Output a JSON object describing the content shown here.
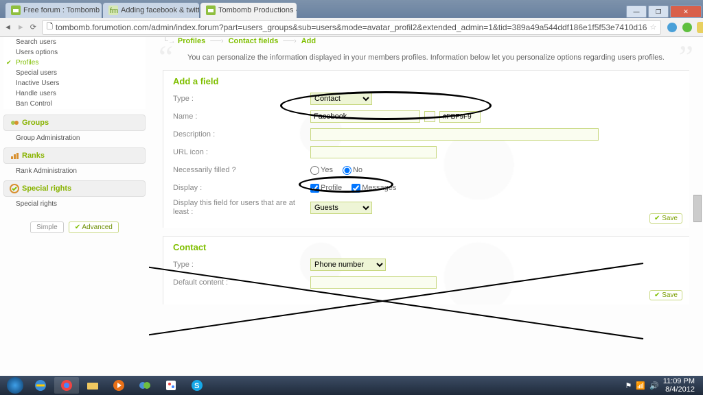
{
  "browser": {
    "tabs": [
      {
        "label": "Free forum : Tombomb P"
      },
      {
        "label": "Adding facebook & twitte"
      },
      {
        "label": "Tombomb Productions - V"
      }
    ],
    "url": "tombomb.forumotion.com/admin/index.forum?part=users_groups&sub=users&mode=avatar_profil2&extended_admin=1&tid=389a49a544ddf186e1f5f53e7410d16"
  },
  "sidebar": {
    "items": [
      "Search users",
      "Users options",
      "Profiles",
      "Special users",
      "Inactive Users",
      "Handle users",
      "Ban Control"
    ],
    "groups_header": "Groups",
    "groups_sub": "Group Administration",
    "ranks_header": "Ranks",
    "ranks_sub": "Rank Administration",
    "special_header": "Special rights",
    "special_sub": "Special rights",
    "simple_btn": "Simple",
    "advanced_btn": "Advanced"
  },
  "breadcrumb": {
    "a": "Profiles",
    "b": "Contact fields",
    "c": "Add"
  },
  "intro": "You can personalize the information displayed in your members profiles. Information below let you personalize options regarding users profiles.",
  "panel1": {
    "title": "Add a field",
    "type_lbl": "Type :",
    "type_val": "Contact",
    "name_lbl": "Name :",
    "name_val": "Facebook",
    "color_hex": "#FBF9F9",
    "desc_lbl": "Description :",
    "desc_val": "",
    "url_lbl": "URL icon :",
    "url_val": "",
    "nec_lbl": "Necessarily filled ?",
    "yes": "Yes",
    "no": "No",
    "disp_lbl": "Display :",
    "profile": "Profile",
    "messages": "Messages",
    "least_lbl": "Display this field for users that are at least :",
    "least_val": "Guests",
    "save": "Save"
  },
  "panel2": {
    "title": "Contact",
    "type_lbl": "Type :",
    "type_val": "Phone number",
    "default_lbl": "Default content :",
    "default_val": "",
    "save": "Save"
  },
  "taskbar": {
    "time": "11:09 PM",
    "date": "8/4/2012"
  }
}
